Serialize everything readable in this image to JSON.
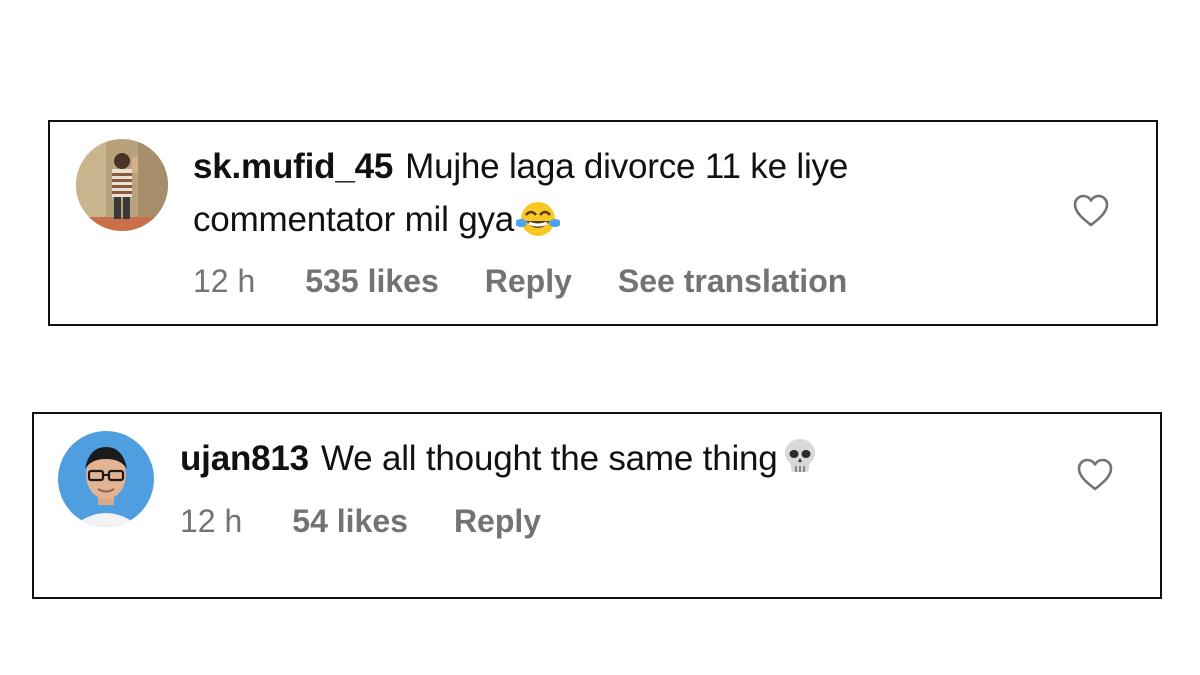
{
  "comments": [
    {
      "username": "sk.mufid_45",
      "text": "Mujhe laga divorce 11 ke liye commentator mil gya",
      "emoji": "face-with-tears-of-joy",
      "time": "12 h",
      "likes": "535 likes",
      "reply_label": "Reply",
      "translate_label": "See translation",
      "avatar": "person-in-striped-sweater-photo"
    },
    {
      "username": "ujan813",
      "text": "We all thought the same thing",
      "emoji": "skull",
      "time": "12 h",
      "likes": "54 likes",
      "reply_label": "Reply",
      "avatar": "young-man-with-glasses-photo"
    }
  ],
  "colors": {
    "meta_text": "#737373",
    "border": "#111111",
    "heart_outline": "#737373"
  }
}
